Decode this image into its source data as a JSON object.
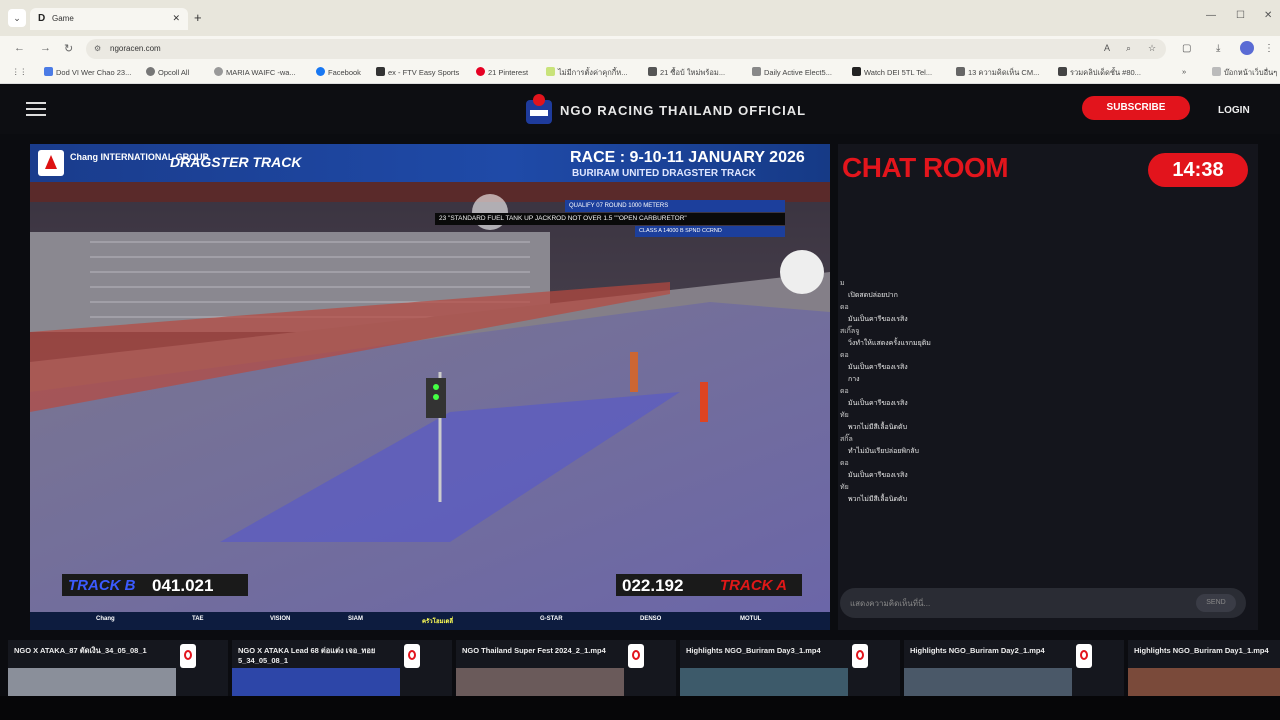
{
  "browser": {
    "tab_title": "Game",
    "url": "ngoracen.com",
    "bookmarks": [
      "Dod VI Wer Chao 23...",
      "Opcoll All",
      "MARIA WAIFC -wa...",
      "Facebook",
      "ex - FTV Easy Sports",
      "21 Pinterest",
      "ไม่มีการตั้งค่าคุกกี้ห...",
      "21 ซื้อบ้ ใหม่พร้อม...",
      "Daily Active Elect5...",
      "Watch DEI 5TL Tel...",
      "13 ความคิดเห็น CM...",
      "รวมคลิปเด็ดชั้น #80...",
      "บ๊อกหน้าเว็บอื่นๆ"
    ]
  },
  "header": {
    "brand": "NGO RACING THAILAND OFFICIAL",
    "subscribe": "SUBSCRIBE",
    "login": "LOGIN"
  },
  "video": {
    "sponsor_group": "Chang INTERNATIONAL GROUP",
    "event_logo": "DRAGSTER TRACK",
    "race_title": "RACE : 9-10-11 JANUARY 2026",
    "race_subtitle": "BURIRAM UNITED DRAGSTER TRACK",
    "info_line1": "QUALIFY 07 ROUND    1000 METERS",
    "info_line2": "23 \"STANDARD FUEL TANK UP JACKROD NOT OVER 1.5 \"\"OPEN CARBURETOR\"",
    "info_line3": "CLASS A 14000 B SPND CCRND",
    "track_b_label": "TRACK B",
    "track_b_value": "041.021",
    "track_a_value": "022.192",
    "track_a_label": "TRACK A",
    "sponsor_strip": [
      "Chang",
      "TAE",
      "VISION",
      "SIAM",
      "ครัวโฮมเดลี่",
      "G-STAR",
      "DENSO",
      "MOTUL"
    ]
  },
  "chat": {
    "title": "CHAT ROOM",
    "timer": "14:38",
    "messages": [
      {
        "name": "ม",
        "text": "เปิดสดปล่อยปาก"
      },
      {
        "name": "ดอ",
        "text": "มันเป็นคารีของเรสิง"
      },
      {
        "name": "สเกิ๊ลจู",
        "text": "วิ่งทำให้แสดงครั้งแรกมยุติม"
      },
      {
        "name": "ดอ",
        "text": "มันเป็นคารีของเรสิง"
      },
      {
        "name": "",
        "text": "กาง"
      },
      {
        "name": "ดอ",
        "text": "มันเป็นคารีของเรสิง"
      },
      {
        "name": "ทัย",
        "text": "พวกไม่มีสีเลื้อนิดดับ"
      },
      {
        "name": "สกิ๊ล",
        "text": "ทำไม่มันเรียปล่อยพิกลับ"
      },
      {
        "name": "ดอ",
        "text": "มันเป็นคารีของเรสิง"
      },
      {
        "name": "ทัย",
        "text": "พวกไม่มีสีเลื้อนิดดับ"
      }
    ],
    "input_placeholder": "แสดงความคิดเห็นที่นี่...",
    "send": "SEND"
  },
  "thumbnails": [
    {
      "caption": "NGO X ATAKA_87 ตัดเงิน_34_05_08_1"
    },
    {
      "caption": "NGO X ATAKA Lead 68 ต่อแต่ง เจอ_ทอย 5_34_05_08_1"
    },
    {
      "caption": "NGO Thailand Super Fest 2024_2_1.mp4"
    },
    {
      "caption": "Highlights NGO_Buriram Day3_1.mp4"
    },
    {
      "caption": "Highlights NGO_Buriram Day2_1.mp4"
    },
    {
      "caption": "Highlights NGO_Buriram Day1_1.mp4"
    }
  ]
}
